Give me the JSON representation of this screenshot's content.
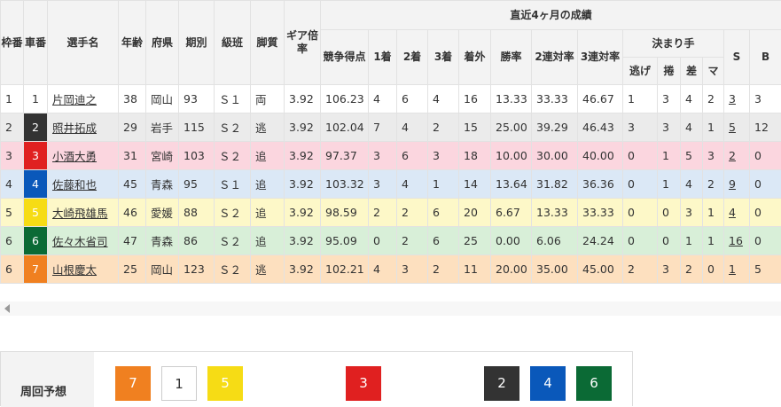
{
  "table": {
    "headers": {
      "waku": "枠番",
      "car": "車番",
      "name": "選手名",
      "age": "年齢",
      "pref": "府県",
      "term": "期別",
      "class": "級班",
      "style": "脚質",
      "gear": "ギア倍率",
      "recent_group": "直近4ヶ月の成績",
      "score": "競争得点",
      "first": "1着",
      "second": "2着",
      "third": "3着",
      "out": "着外",
      "win_rate": "勝率",
      "quinella_rate": "2連対率",
      "trio_rate": "3連対率",
      "kimarite_group": "決まり手",
      "nige": "逃げ",
      "makuri": "捲",
      "sashi": "差",
      "ma": "マ",
      "s": "S",
      "b": "B"
    },
    "rows": [
      {
        "waku": "1",
        "car": "1",
        "name": "片岡迪之",
        "age": "38",
        "pref": "岡山",
        "term": "93",
        "class": "Ｓ１",
        "style": "両",
        "gear": "3.92",
        "score": "106.23",
        "first": "4",
        "second": "6",
        "third": "4",
        "out": "16",
        "win_rate": "13.33",
        "quinella_rate": "33.33",
        "trio_rate": "46.67",
        "nige": "1",
        "makuri": "3",
        "sashi": "4",
        "ma": "2",
        "s": "3",
        "b": "3"
      },
      {
        "waku": "2",
        "car": "2",
        "name": "照井拓成",
        "age": "29",
        "pref": "岩手",
        "term": "115",
        "class": "Ｓ２",
        "style": "逃",
        "gear": "3.92",
        "score": "102.04",
        "first": "7",
        "second": "4",
        "third": "2",
        "out": "15",
        "win_rate": "25.00",
        "quinella_rate": "39.29",
        "trio_rate": "46.43",
        "nige": "3",
        "makuri": "3",
        "sashi": "4",
        "ma": "1",
        "s": "5",
        "b": "12"
      },
      {
        "waku": "3",
        "car": "3",
        "name": "小酒大勇",
        "age": "31",
        "pref": "宮崎",
        "term": "103",
        "class": "Ｓ２",
        "style": "追",
        "gear": "3.92",
        "score": "97.37",
        "first": "3",
        "second": "6",
        "third": "3",
        "out": "18",
        "win_rate": "10.00",
        "quinella_rate": "30.00",
        "trio_rate": "40.00",
        "nige": "0",
        "makuri": "1",
        "sashi": "5",
        "ma": "3",
        "s": "2",
        "b": "0"
      },
      {
        "waku": "4",
        "car": "4",
        "name": "佐藤和也",
        "age": "45",
        "pref": "青森",
        "term": "95",
        "class": "Ｓ１",
        "style": "追",
        "gear": "3.92",
        "score": "103.32",
        "first": "3",
        "second": "4",
        "third": "1",
        "out": "14",
        "win_rate": "13.64",
        "quinella_rate": "31.82",
        "trio_rate": "36.36",
        "nige": "0",
        "makuri": "1",
        "sashi": "4",
        "ma": "2",
        "s": "9",
        "b": "0"
      },
      {
        "waku": "5",
        "car": "5",
        "name": "大崎飛雄馬",
        "age": "46",
        "pref": "愛媛",
        "term": "88",
        "class": "Ｓ２",
        "style": "追",
        "gear": "3.92",
        "score": "98.59",
        "first": "2",
        "second": "2",
        "third": "6",
        "out": "20",
        "win_rate": "6.67",
        "quinella_rate": "13.33",
        "trio_rate": "33.33",
        "nige": "0",
        "makuri": "0",
        "sashi": "3",
        "ma": "1",
        "s": "4",
        "b": "0"
      },
      {
        "waku": "6",
        "car": "6",
        "name": "佐々木省司",
        "age": "47",
        "pref": "青森",
        "term": "86",
        "class": "Ｓ２",
        "style": "追",
        "gear": "3.92",
        "score": "95.09",
        "first": "0",
        "second": "2",
        "third": "6",
        "out": "25",
        "win_rate": "0.00",
        "quinella_rate": "6.06",
        "trio_rate": "24.24",
        "nige": "0",
        "makuri": "0",
        "sashi": "1",
        "ma": "1",
        "s": "16",
        "b": "0"
      },
      {
        "waku": "6",
        "car": "7",
        "name": "山根慶太",
        "age": "25",
        "pref": "岡山",
        "term": "123",
        "class": "Ｓ２",
        "style": "逃",
        "gear": "3.92",
        "score": "102.21",
        "first": "4",
        "second": "3",
        "third": "2",
        "out": "11",
        "win_rate": "20.00",
        "quinella_rate": "35.00",
        "trio_rate": "45.00",
        "nige": "2",
        "makuri": "3",
        "sashi": "2",
        "ma": "0",
        "s": "1",
        "b": "5"
      }
    ]
  },
  "car_colors": {
    "1": {
      "bg": "#ffffff",
      "fg": "#333333"
    },
    "2": {
      "bg": "#333333",
      "fg": "#ffffff"
    },
    "3": {
      "bg": "#e02020",
      "fg": "#ffffff"
    },
    "4": {
      "bg": "#0a58ba",
      "fg": "#ffffff"
    },
    "5": {
      "bg": "#f6dc15",
      "fg": "#ffffff"
    },
    "6": {
      "bg": "#0b6a35",
      "fg": "#ffffff"
    },
    "7": {
      "bg": "#f08020",
      "fg": "#ffffff"
    }
  },
  "row_colors": [
    "#ffffff",
    "#ebebeb",
    "#fbd6df",
    "#dbe8f6",
    "#fdf8c8",
    "#d8efd8",
    "#fde0bf"
  ],
  "yoso": {
    "label": "周回予想",
    "chips": [
      "7",
      "1",
      "5",
      "3",
      "2",
      "4",
      "6"
    ]
  }
}
